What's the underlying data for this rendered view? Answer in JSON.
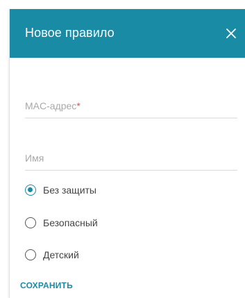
{
  "dialog": {
    "title": "Новое правило",
    "accent_color": "#1a8ba5",
    "close_icon": "close-icon"
  },
  "form": {
    "mac_field": {
      "label": "MAC-адрес",
      "required_marker": "*",
      "value": ""
    },
    "name_field": {
      "label": "Имя",
      "value": ""
    },
    "security_options": [
      {
        "label": "Без защиты",
        "selected": true
      },
      {
        "label": "Безопасный",
        "selected": false
      },
      {
        "label": "Детский",
        "selected": false
      }
    ]
  },
  "actions": {
    "save_label": "СОХРАНИТЬ"
  }
}
